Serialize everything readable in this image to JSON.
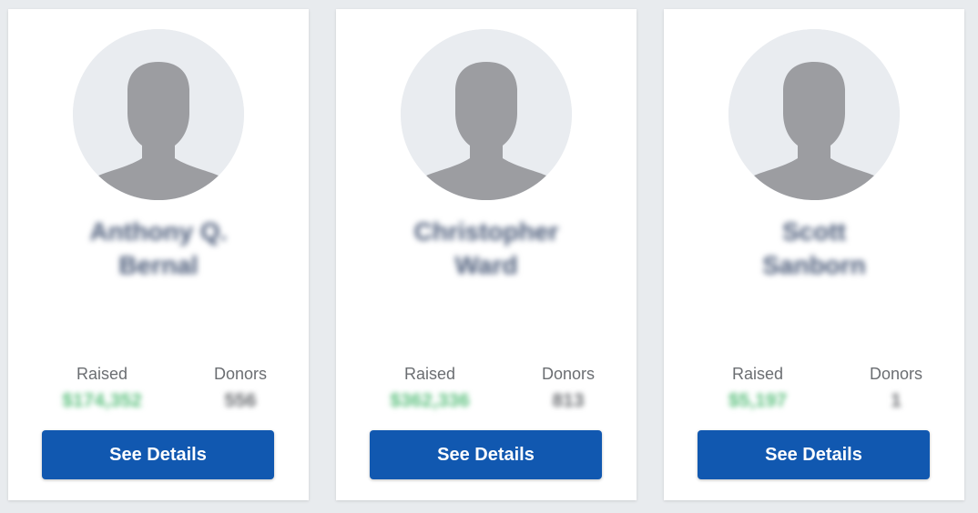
{
  "colors": {
    "page_background": "#e8ebee",
    "card_background": "#ffffff",
    "button": "#1158b0",
    "button_text": "#ffffff",
    "name_text": "#4a5a78",
    "raised_value": "#5cc07e",
    "label_text": "#6b6e72",
    "avatar_background": "#e9ecf0",
    "avatar_silhouette": "#9c9da1"
  },
  "cards": [
    {
      "avatar_icon": "default-user-silhouette",
      "name_line1": "Anthony Q.",
      "name_line2": "Bernal",
      "raised_label": "Raised",
      "raised_value": "$174,352",
      "donors_label": "Donors",
      "donors_value": "556",
      "button_label": "See Details"
    },
    {
      "avatar_icon": "default-user-silhouette",
      "name_line1": "Christopher",
      "name_line2": "Ward",
      "raised_label": "Raised",
      "raised_value": "$362,336",
      "donors_label": "Donors",
      "donors_value": "813",
      "button_label": "See Details"
    },
    {
      "avatar_icon": "default-user-silhouette",
      "name_line1": "Scott",
      "name_line2": "Sanborn",
      "raised_label": "Raised",
      "raised_value": "$5,197",
      "donors_label": "Donors",
      "donors_value": "1",
      "button_label": "See Details"
    }
  ]
}
